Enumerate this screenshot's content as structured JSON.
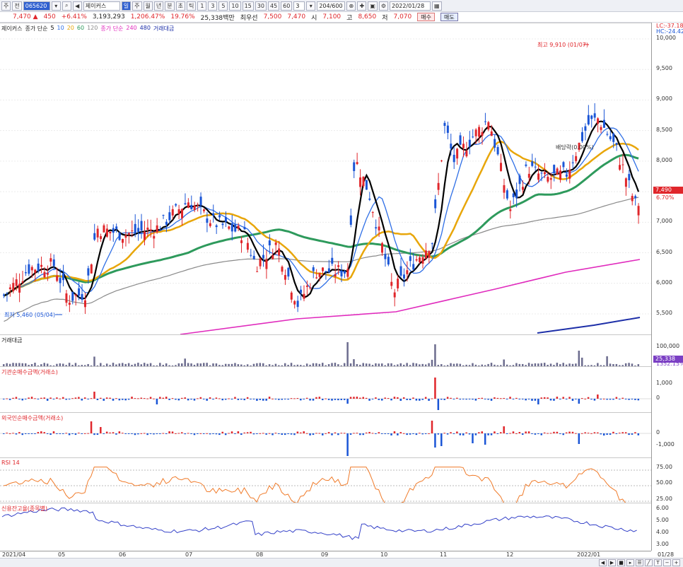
{
  "toolbar": {
    "menu_label": "주",
    "market_label": "전",
    "code": "065620",
    "stock_name": "제이커스",
    "period_buttons": [
      "주",
      "월",
      "년",
      "분",
      "초",
      "틱"
    ],
    "minute_buttons": [
      "1",
      "3",
      "5",
      "10",
      "15",
      "30",
      "45",
      "60"
    ],
    "count_value": "3",
    "range_value": "204/600",
    "date_value": "2022/01/28"
  },
  "price_bar": {
    "price": "7,470",
    "change_arrow": "▲",
    "change": "450",
    "change_pct": "+6.41%",
    "volume": "3,193,293",
    "volume_ratio": "1,206.47%",
    "turnover": "19.76%",
    "amount": "25,338백만",
    "best_label": "최우선",
    "best_ask": "7,500",
    "best_bid": "7,470",
    "open_label": "시",
    "open": "7,100",
    "high_label": "고",
    "high": "8,650",
    "low_label": "저",
    "low": "7,070",
    "buy_label": "매수",
    "sell_label": "매도"
  },
  "main_legend": {
    "stock": "제이커스",
    "ma_title": "종가 단순",
    "ma_periods": [
      "5",
      "10",
      "20",
      "60",
      "120"
    ],
    "long_title": "종가 단순",
    "long_periods": [
      "240",
      "480"
    ],
    "amount_title": "거래대금"
  },
  "main_axis": {
    "lc": "LC:-37.18",
    "hc": "HC:-24.42",
    "ticks": [
      "10,000",
      "9,500",
      "9,000",
      "8,500",
      "8,000",
      "7,500",
      "7,000",
      "6,500",
      "6,000",
      "5,500"
    ],
    "current_price": "7,490",
    "current_pct": "6.70%"
  },
  "annotations": {
    "high_note": "최고 9,910 (01/07)",
    "low_note": "최저 5,460 (05/04)",
    "dividend_note": "배당락(0.00%)"
  },
  "volume_panel": {
    "title": "거래대금",
    "tick": "100,000",
    "badge_value": "25,338",
    "badge_pct": "1352.15%"
  },
  "inst_panel": {
    "title": "기관순매수금액(거래소)",
    "ticks": [
      "1,000",
      "0"
    ]
  },
  "foreign_panel": {
    "title": "외국인순매수금액(거래소)",
    "ticks": [
      "0",
      "-1,000"
    ]
  },
  "rsi_panel": {
    "title": "RSI 14",
    "ticks": [
      "75.00",
      "50.00",
      "25.00"
    ]
  },
  "credit_panel": {
    "title": "신용잔고율(종목별)",
    "ticks": [
      "6.00",
      "5.00",
      "4.00",
      "3.00"
    ]
  },
  "date_axis": [
    "2021/04",
    "05",
    "06",
    "07",
    "08",
    "09",
    "10",
    "11",
    "12",
    "2022/01",
    "01/28"
  ],
  "colors": {
    "up": "#e0262b",
    "down": "#1a55d6",
    "ma5": "#000000",
    "ma10": "#2f6fe6",
    "ma20": "#e8a60a",
    "ma60": "#2e9a5c",
    "ma120": "#8a8a8a",
    "ma240": "#e02bbd",
    "ma480": "#1d2fa8",
    "rsi": "#f07b2a",
    "credit": "#3340c8"
  }
}
